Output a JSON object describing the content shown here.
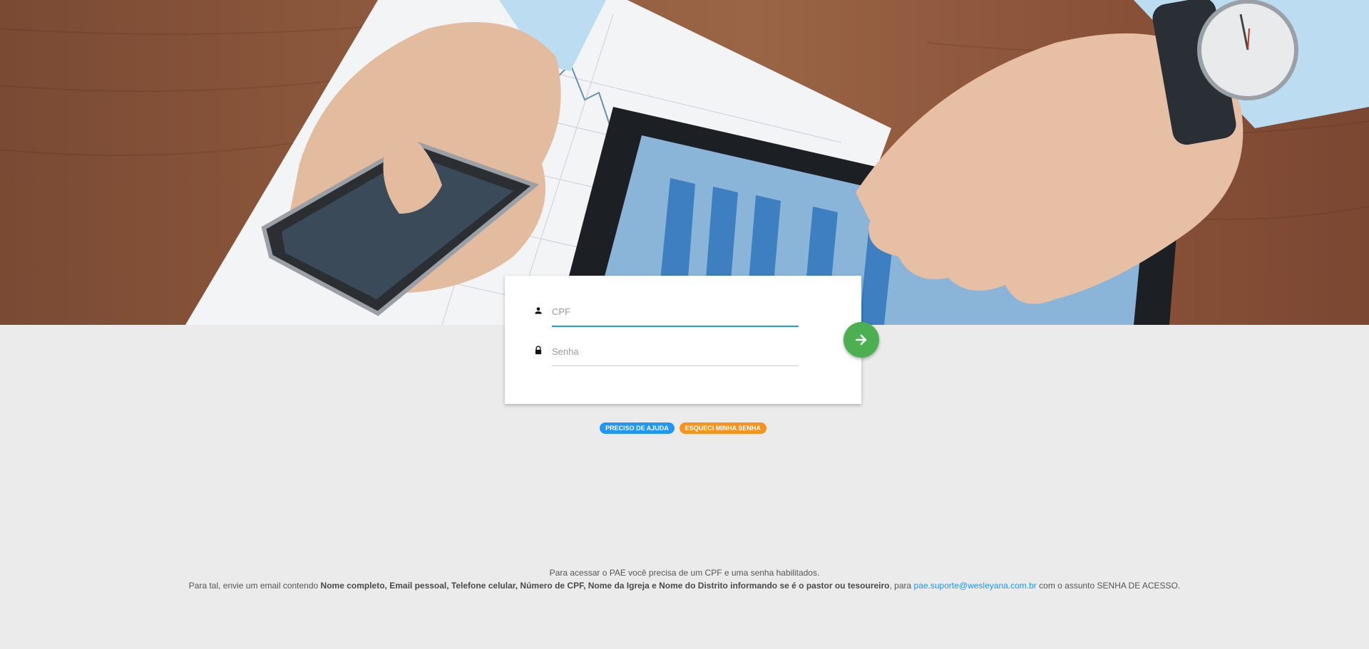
{
  "login": {
    "cpf_placeholder": "CPF",
    "senha_placeholder": "Senha",
    "cpf_value": "",
    "senha_value": ""
  },
  "icons": {
    "user": "person-icon",
    "password": "lock-icon",
    "submit": "arrow-right-icon"
  },
  "links": {
    "help_label": "PRECISO DE AJUDA",
    "forgot_label": "ESQUECI MINHA SENHA"
  },
  "info": {
    "line1": "Para acessar o PAE você precisa de um CPF e uma senha habilitados.",
    "line2_prefix": "Para tal, envie um email contendo ",
    "line2_bold": "Nome completo, Email pessoal, Telefone celular, Número de CPF, Nome da Igreja e Nome do Distrito informando se é o pastor ou tesoureiro",
    "line2_mid": ", para ",
    "email": "pae.suporte@wesleyana.com.br",
    "line2_suffix": " com o assunto SENHA DE ACESSO."
  },
  "colors": {
    "primary": "#2196f3",
    "success": "#4caf50",
    "warning": "#f7941d",
    "background": "#ebebeb"
  }
}
